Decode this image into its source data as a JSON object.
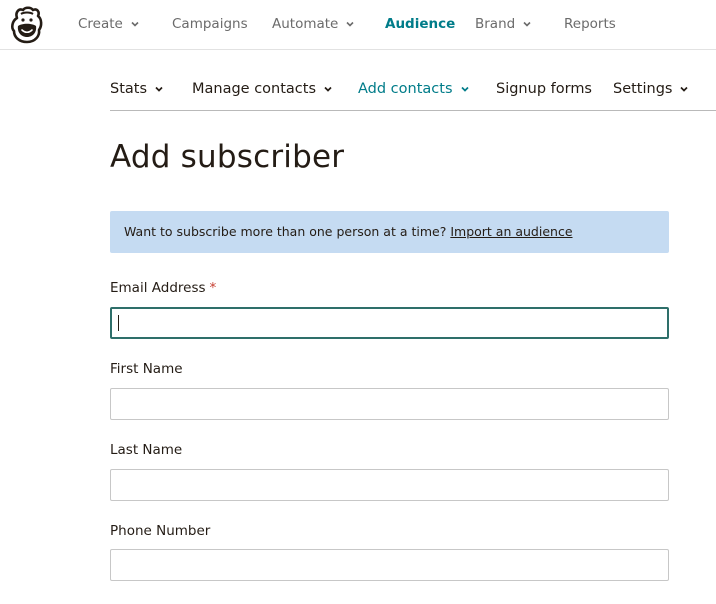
{
  "topnav": {
    "items": [
      {
        "label": "Create",
        "has_dropdown": true
      },
      {
        "label": "Campaigns",
        "has_dropdown": false
      },
      {
        "label": "Automate",
        "has_dropdown": true
      },
      {
        "label": "Audience",
        "has_dropdown": false,
        "active": true
      },
      {
        "label": "Brand",
        "has_dropdown": true
      },
      {
        "label": "Reports",
        "has_dropdown": false
      }
    ]
  },
  "subnav": {
    "items": [
      {
        "label": "Stats",
        "has_dropdown": true
      },
      {
        "label": "Manage contacts",
        "has_dropdown": true
      },
      {
        "label": "Add contacts",
        "has_dropdown": true,
        "active": true
      },
      {
        "label": "Signup forms",
        "has_dropdown": false
      },
      {
        "label": "Settings",
        "has_dropdown": true
      }
    ]
  },
  "page": {
    "title": "Add subscriber"
  },
  "banner": {
    "text": "Want to subscribe more than one person at a time?",
    "link": "Import an audience"
  },
  "form": {
    "email": {
      "label": "Email Address",
      "required_mark": "*",
      "value": ""
    },
    "first_name": {
      "label": "First Name",
      "value": ""
    },
    "last_name": {
      "label": "Last Name",
      "value": ""
    },
    "phone": {
      "label": "Phone Number",
      "value": ""
    }
  },
  "colors": {
    "accent": "#007c89",
    "banner_bg": "#c5dbf2",
    "required": "#c63d2f",
    "text": "#241c15"
  }
}
